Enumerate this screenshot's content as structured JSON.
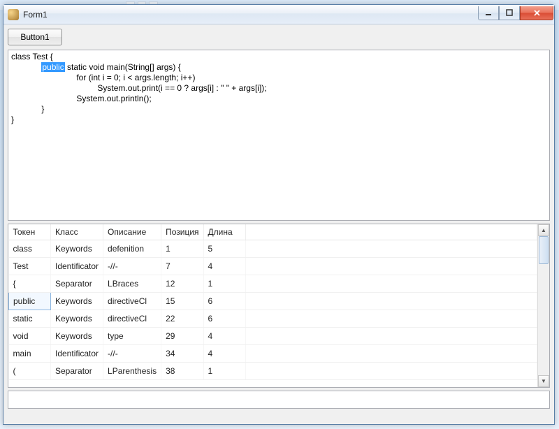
{
  "window": {
    "title": "Form1"
  },
  "toolbar": {
    "button1_label": "Button1"
  },
  "code": {
    "line1_a": "class Test {",
    "line2_indent": "             ",
    "line2_hl": "public",
    "line2_b": " static void main(String[] args) {",
    "line3": "                            for (int i = 0; i < args.length; i++)",
    "line4": "                                     System.out.print(i == 0 ? args[i] : \" \" + args[i]);",
    "line5": "                            System.out.println();",
    "line6": "             }",
    "line7": "}"
  },
  "table": {
    "columns": [
      "Токен",
      "Класс",
      "Описание",
      "Позиция",
      "Длина"
    ],
    "selected_row": 3,
    "selected_col": 0,
    "rows": [
      {
        "token": "class",
        "klass": "Keywords",
        "desc": "defenition",
        "pos": "1",
        "len": "5"
      },
      {
        "token": "Test",
        "klass": "Identificator",
        "desc": "-//-",
        "pos": "7",
        "len": "4"
      },
      {
        "token": "{",
        "klass": "Separator",
        "desc": "LBraces",
        "pos": "12",
        "len": "1"
      },
      {
        "token": "public",
        "klass": "Keywords",
        "desc": "directiveCl",
        "pos": "15",
        "len": "6"
      },
      {
        "token": "static",
        "klass": "Keywords",
        "desc": "directiveCl",
        "pos": "22",
        "len": "6"
      },
      {
        "token": "void",
        "klass": "Keywords",
        "desc": "type",
        "pos": "29",
        "len": "4"
      },
      {
        "token": "main",
        "klass": "Identificator",
        "desc": "-//-",
        "pos": "34",
        "len": "4"
      },
      {
        "token": "(",
        "klass": "Separator",
        "desc": "LParenthesis",
        "pos": "38",
        "len": "1"
      }
    ]
  }
}
